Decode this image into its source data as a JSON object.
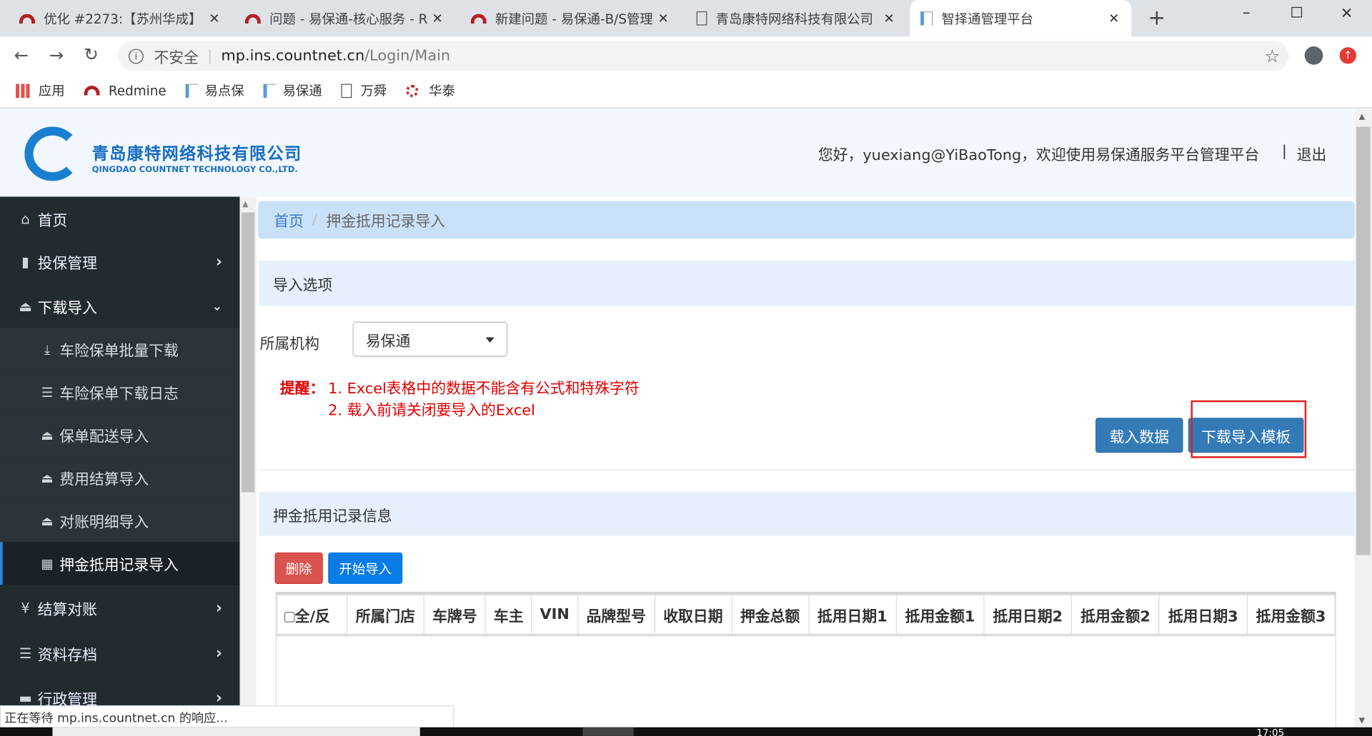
{
  "browser": {
    "tabs": [
      {
        "title": "优化 #2273:【苏州华成】",
        "icon": "redmine-icon"
      },
      {
        "title": "问题 - 易保通-核心服务 - R",
        "icon": "redmine-icon"
      },
      {
        "title": "新建问题 - 易保通-B/S管理",
        "icon": "redmine-icon"
      },
      {
        "title": "青岛康特网络科技有限公司",
        "icon": "page-icon"
      },
      {
        "title": "智择通管理平台",
        "icon": "doc-icon",
        "active": true
      }
    ],
    "security_label": "不安全",
    "url_host": "mp.ins.countnet.cn",
    "url_path": "/Login/Main",
    "bookmarks": [
      "应用",
      "Redmine",
      "易点保",
      "易保通",
      "万舜",
      "华泰"
    ],
    "status_text": "正在等待 mp.ins.countnet.cn 的响应...",
    "clock": "17:05"
  },
  "header": {
    "company_cn": "青岛康特网络科技有限公司",
    "company_en": "QINGDAO COUNTNET TECHNOLOGY CO.,LTD.",
    "greeting": "您好，yuexiang@YiBaoTong，欢迎使用易保通服务平台管理平台",
    "logout": "退出"
  },
  "sidebar": {
    "items": [
      {
        "label": "首页",
        "icon": "home-icon"
      },
      {
        "label": "投保管理",
        "icon": "file-icon"
      },
      {
        "label": "下载导入",
        "icon": "upload-icon"
      },
      {
        "label": "结算对账",
        "icon": "yen-icon"
      },
      {
        "label": "资料存档",
        "icon": "list-icon"
      },
      {
        "label": "行政管理",
        "icon": "briefcase-icon"
      }
    ],
    "subitems": [
      {
        "label": "车险保单批量下载",
        "icon": "download-icon"
      },
      {
        "label": "车险保单下载日志",
        "icon": "list-icon"
      },
      {
        "label": "保单配送导入",
        "icon": "upload-icon"
      },
      {
        "label": "费用结算导入",
        "icon": "upload-icon"
      },
      {
        "label": "对账明细导入",
        "icon": "upload-icon"
      },
      {
        "label": "押金抵用记录导入",
        "icon": "grid-icon",
        "active": true
      }
    ]
  },
  "breadcrumb": {
    "home": "首页",
    "current": "押金抵用记录导入"
  },
  "import_options": {
    "title": "导入选项",
    "org_label": "所属机构",
    "org_value": "易保通",
    "reminder_label": "提醒：",
    "reminders": [
      "1. Excel表格中的数据不能含有公式和特殊字符",
      "2. 载入前请关闭要导入的Excel"
    ],
    "load_button": "载入数据",
    "template_button": "下载导入模板"
  },
  "records": {
    "title": "押金抵用记录信息",
    "delete_button": "删除",
    "start_button": "开始导入",
    "columns": [
      "全/反",
      "所属门店",
      "车牌号",
      "车主",
      "VIN",
      "品牌型号",
      "收取日期",
      "押金总额",
      "抵用日期1",
      "抵用金额1",
      "抵用日期2",
      "抵用金额2",
      "抵用日期3",
      "抵用金额3"
    ],
    "rows": []
  },
  "colors": {
    "sidebar": "#222b30",
    "primary": "#337ab7",
    "danger": "#d9534f",
    "start": "#0a7ce6",
    "reminder": "#e00000",
    "highlight": "#e0201c"
  }
}
